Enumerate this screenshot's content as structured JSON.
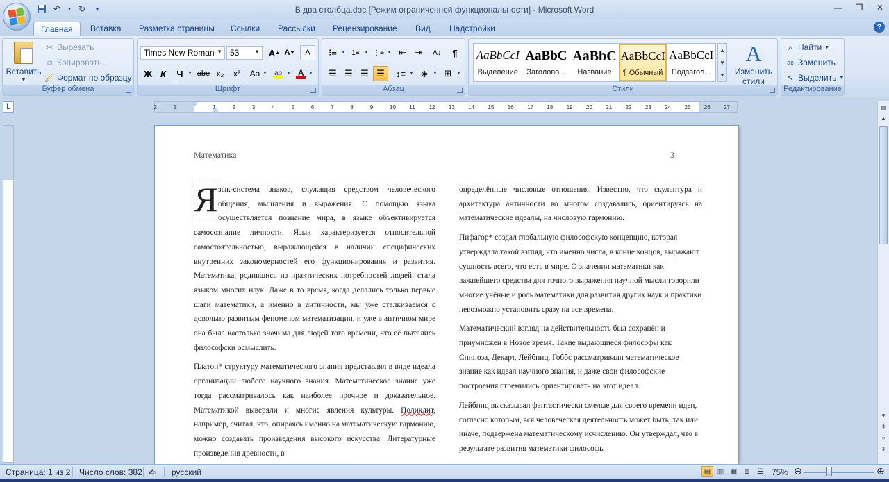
{
  "window": {
    "title": "В два столбца.doc [Режим ограниченной функциональности] - Microsoft Word",
    "minimize": "—",
    "maximize": "❐",
    "close": "✕"
  },
  "qat": [
    "save-icon",
    "undo-icon",
    "redo-icon",
    "customize-icon"
  ],
  "tabs": [
    "Главная",
    "Вставка",
    "Разметка страницы",
    "Ссылки",
    "Рассылки",
    "Рецензирование",
    "Вид",
    "Надстройки"
  ],
  "clipboard": {
    "paste": "Вставить",
    "cut": "Вырезать",
    "copy": "Копировать",
    "format_painter": "Формат по образцу",
    "label": "Буфер обмена"
  },
  "font": {
    "name": "Times New Roman",
    "size": "53",
    "label": "Шрифт",
    "bold": "Ж",
    "italic": "К",
    "underline": "Ч",
    "strike": "abe",
    "subscript": "x₂",
    "superscript": "x²",
    "case": "Aa",
    "grow": "A",
    "shrink": "A",
    "clear": "A"
  },
  "paragraph": {
    "label": "Абзац"
  },
  "styles": {
    "label": "Стили",
    "items": [
      {
        "preview": "AaBbCcI",
        "name": "Выделение",
        "selected": false
      },
      {
        "preview": "AaBbC",
        "name": "Заголово...",
        "selected": false
      },
      {
        "preview": "AaBbC",
        "name": "Название",
        "selected": false
      },
      {
        "preview": "AaBbCcI",
        "name": "¶ Обычный",
        "selected": true
      },
      {
        "preview": "AaBbCcI",
        "name": "Подзагол...",
        "selected": false
      }
    ],
    "change": "Изменить стили"
  },
  "editing": {
    "label": "Редактирование",
    "find": "Найти",
    "replace": "Заменить",
    "select": "Выделить"
  },
  "ruler": {
    "corner": "L",
    "ticks": [
      "2",
      "1",
      "1",
      "2",
      "3",
      "4",
      "5",
      "6",
      "7",
      "8",
      "9",
      "10",
      "11",
      "12",
      "13",
      "14",
      "15",
      "16",
      "17",
      "18",
      "19",
      "20",
      "21",
      "22",
      "23",
      "24",
      "25",
      "26",
      "27"
    ]
  },
  "document": {
    "header_left": "Математика",
    "header_right": "3",
    "dropcap": "Я",
    "left_col": [
      "зык-система знаков, служащая средством человеческого общения, мышления и выражения. С помощью языка осуществляется познание мира, в языке объективируется самосознание личности. Язык характеризуется относительной самостоятельностью, выражающейся в наличии специфических внутренних закономерностей его функционирования и развития. Математика, родившись из практических потребностей людей, стала языком многих наук. Даже в то время, когда делались только первые шаги математики, а именно в античности, мы уже сталкиваемся с довольно развитым феноменом математизации, и уже в античном мире она была настолько значима для людей того времени, что её пытались философски осмыслить."
    ],
    "left_p2_before": "Платон* структуру математического знания представлял в виде идеала организации любого научного знания. Математическое знание уже тогда рассматривалось как наиболее прочное и доказательное. Математикой выверяли и многие явления культуры.",
    "left_p2_squiggle": "Поликлит",
    "left_p2_after": ", например, считал, что, опираясь именно на математическую гармонию, можно создавать произведения высокого искусства. Литературные произведения древности, в",
    "right_col": [
      "определённые числовые отношения. Известно, что скульптура и архитектура античности во многом создавались, ориентируясь на математические идеалы, на числовую гармонию.",
      "Пифагор* создал глобальную философскую концепцию, которая утверждала такой взгляд, что именно числа, в конце концов, выражают сущность всего, что есть в мире. О значении математики как важнейшего средства для точного выражения научной мысли говорили многие учёные и роль математики для развития других наук и практики невозможно установить сразу на все времена.",
      "Математический взгляд на действительность был сохранён и приумножен в Новое время. Такие выдающиеся философы как Спиноза, Декарт, Лейбниц, Гоббс рассматривали математическое знание как идеал научного знания, и даже свои философские построения стремились ориентировать на этот идеал.",
      "Лейбниц высказывал фантастически смелые для своего времени идеи, согласно которым, вся человеческая деятельность может быть, так или иначе, подвержена математическому исчислению. Он утверждал, что в результате развития математики философы"
    ]
  },
  "status": {
    "page": "Страница: 1 из 2",
    "words": "Число слов: 382",
    "language": "русский",
    "zoom": "75%"
  },
  "colors": {
    "accent": "#15428b",
    "ribbon": "#dae6f6",
    "selected_style": "#ffe49a"
  }
}
